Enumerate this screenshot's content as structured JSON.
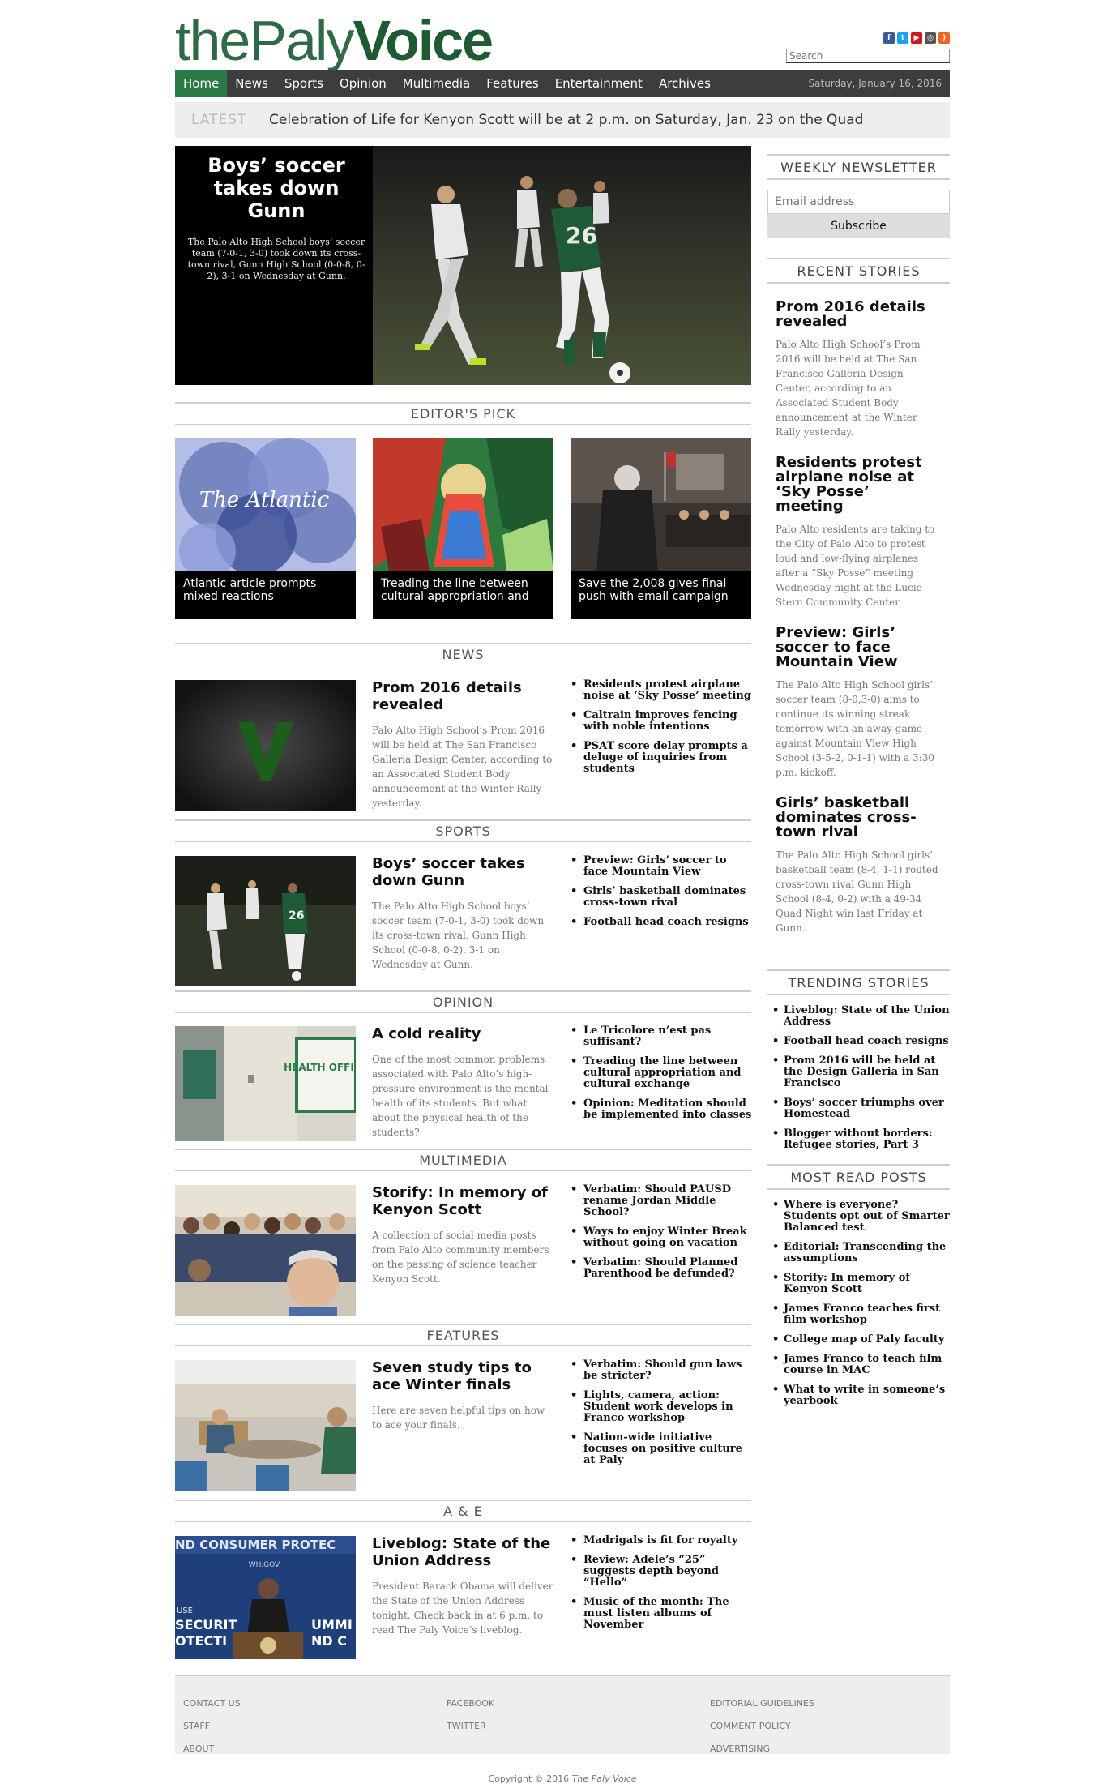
{
  "logo": {
    "part1": "the",
    "part2": "Paly",
    "part3": "Voice"
  },
  "social": [
    {
      "icon": "facebook-icon",
      "label": "f",
      "color": "#3b5998"
    },
    {
      "icon": "twitter-icon",
      "label": "t",
      "color": "#1da1f2"
    },
    {
      "icon": "youtube-icon",
      "label": "▶",
      "color": "#cc181e"
    },
    {
      "icon": "instagram-icon",
      "label": "◎",
      "color": "#555555"
    },
    {
      "icon": "rss-icon",
      "label": ")",
      "color": "#f26522"
    }
  ],
  "search": {
    "placeholder": "Search"
  },
  "nav": {
    "items": [
      "Home",
      "News",
      "Sports",
      "Opinion",
      "Multimedia",
      "Features",
      "Entertainment",
      "Archives"
    ],
    "date": "Saturday, January 16, 2016"
  },
  "latest": {
    "label": "LATEST",
    "text": "Celebration of Life for Kenyon Scott will be at 2 p.m. on Saturday, Jan. 23 on the Quad"
  },
  "hero": {
    "title": "Boys’ soccer takes down Gunn",
    "summary": "The Palo Alto High School boys’ soccer team (7-0-1, 3-0) took down its cross-town rival, Gunn High School (0-0-8, 0-2), 3-1 on Wednesday at Gunn."
  },
  "editors_pick": {
    "heading": "EDITOR'S PICK",
    "items": [
      {
        "caption": "Atlantic article prompts mixed reactions",
        "image_text": "The Atlantic"
      },
      {
        "caption": "Treading the line between cultural appropriation and"
      },
      {
        "caption": "Save the 2,008 gives final push with email campaign"
      }
    ]
  },
  "sections": [
    {
      "heading": "NEWS",
      "title": "Prom 2016 details revealed",
      "summary": "Palo Alto High School’s Prom 2016 will be held at The San Francisco Galleria Design Center, according to an Associated Student Body announcement at the Winter Rally yesterday.",
      "list": [
        "Residents protest airplane noise at ‘Sky Posse’ meeting",
        "Caltrain improves fencing with noble intentions",
        "PSAT score delay prompts a deluge of inquiries from students"
      ]
    },
    {
      "heading": "SPORTS",
      "title": "Boys’ soccer takes down Gunn",
      "summary": "The Palo Alto High School boys’ soccer team (7-0-1, 3-0) took down its cross-town rival, Gunn High School (0-0-8, 0-2), 3-1 on Wednesday at Gunn.",
      "list": [
        "Preview: Girls’ soccer to face Mountain View",
        "Girls’ basketball dominates cross-town rival",
        "Football head coach resigns"
      ]
    },
    {
      "heading": "OPINION",
      "title": "A cold reality",
      "summary": "One of the most common problems associated with Palo Alto’s high-pressure environment is the mental health of its students. But what about the physical health of the students?",
      "image_text": "HEALTH OFFICE",
      "list": [
        "Le Tricolore n’est pas suffisant?",
        "Treading the line between cultural appropriation and cultural exchange",
        "Opinion: Meditation should be implemented into classes"
      ]
    },
    {
      "heading": "MULTIMEDIA",
      "title": "Storify: In memory of Kenyon Scott",
      "summary": "A collection of social media posts from Palo Alto community members on the passing of science teacher Kenyon Scott.",
      "list": [
        "Verbatim: Should PAUSD rename Jordan Middle School?",
        "Ways to enjoy Winter Break without going on vacation",
        "Verbatim: Should Planned Parenthood be defunded?"
      ]
    },
    {
      "heading": "FEATURES",
      "title": "Seven study tips to ace Winter finals",
      "summary": "Here are seven helpful tips on how to ace your finals.",
      "list": [
        "Verbatim: Should gun laws be stricter?",
        "Lights, camera, action: Student work develops in Franco workshop",
        "Nation-wide initiative focuses on positive culture at Paly"
      ]
    },
    {
      "heading": "A & E",
      "title": "Liveblog: State of the Union Address",
      "summary": "President Barack Obama will deliver the State of the Union Address tonight. Check back in at 6 p.m. to read The Paly Voice’s liveblog.",
      "image_text_top": "ND CONSUMER PROTEC",
      "image_text_mid": "WH.GOV",
      "image_text_l1": "USE",
      "image_text_l2": "SECURIT",
      "image_text_l3": "OTECTI",
      "image_text_r1": "UMMI",
      "image_text_r2": "ND C",
      "list": [
        "Madrigals is fit for royalty",
        "Review: Adele’s “25” suggests depth beyond “Hello”",
        "Music of the month: The must listen albums of November"
      ]
    }
  ],
  "sidebar": {
    "newsletter": {
      "heading": "WEEKLY NEWSLETTER",
      "placeholder": "Email address",
      "button": "Subscribe"
    },
    "recent": {
      "heading": "RECENT STORIES",
      "items": [
        {
          "title": "Prom 2016 details revealed",
          "summary": "Palo Alto High School’s Prom 2016 will be held at The San Francisco Galleria Design Center, according to an Associated Student Body announcement at the Winter Rally yesterday."
        },
        {
          "title": "Residents protest airplane noise at ‘Sky Posse’ meeting",
          "summary": "Palo Alto residents are taking to the City of Palo Alto to protest loud and low-flying airplanes after a “Sky Posse” meeting Wednesday night at the Lucie Stern Community Center."
        },
        {
          "title": "Preview: Girls’ soccer to face Mountain View",
          "summary": "The Palo Alto High School girls’ soccer team (8-0,3-0) aims to continue its winning streak tomorrow with an away game against Mountain View High School (3-5-2, 0-1-1) with a 3:30 p.m. kickoff."
        },
        {
          "title": "Girls’ basketball dominates cross-town rival",
          "summary": "The Palo Alto High School girls’ basketball team (8-4, 1-1) routed cross-town rival Gunn High School (8-4, 0-2) with a 49-34 Quad Night win last Friday at Gunn."
        }
      ]
    },
    "trending": {
      "heading": "TRENDING STORIES",
      "items": [
        "Liveblog: State of the Union Address",
        "Football head coach resigns",
        "Prom 2016 will be held at the Design Galleria in San Francisco",
        "Boys’ soccer triumphs over Homestead",
        "Blogger without borders: Refugee stories, Part 3"
      ]
    },
    "most_read": {
      "heading": "MOST READ POSTS",
      "items": [
        "Where is everyone? Students opt out of Smarter Balanced test",
        "Editorial: Transcending the assumptions",
        "Storify: In memory of Kenyon Scott",
        "James Franco teaches first film workshop",
        "College map of Paly faculty",
        "James Franco to teach film course in MAC",
        "What to write in someone’s yearbook"
      ]
    }
  },
  "footer": {
    "col1": [
      "CONTACT US",
      "STAFF",
      "ABOUT"
    ],
    "col2": [
      "FACEBOOK",
      "TWITTER"
    ],
    "col3": [
      "EDITORIAL GUIDELINES",
      "COMMENT POLICY",
      "ADVERTISING"
    ],
    "copyright": "Copyright © 2016",
    "copyright_name": "The Paly Voice"
  }
}
